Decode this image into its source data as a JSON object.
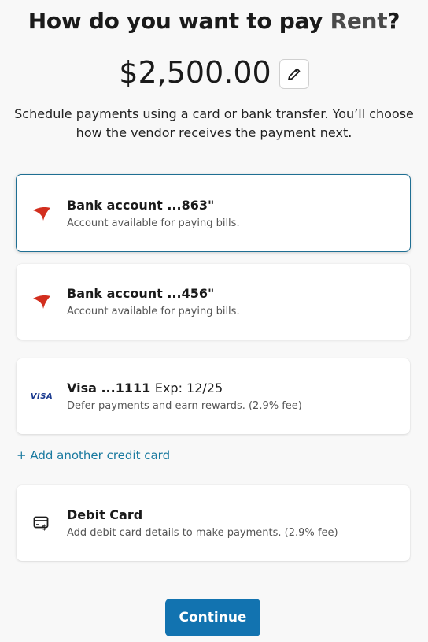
{
  "header": {
    "title_prefix": "How do you want to pay ",
    "vendor_name": "Rent",
    "title_suffix": "?"
  },
  "amount": "$2,500.00",
  "subtitle": "Schedule payments using a card or bank transfer. You’ll choose how the vendor receives the payment next.",
  "payment_methods": [
    {
      "title": "Bank account ...863\"",
      "description": "Account available for paying bills.",
      "icon": "bank-swoosh-icon",
      "selected": true
    },
    {
      "title": "Bank account ...456\"",
      "description": "Account available for paying bills.",
      "icon": "bank-swoosh-icon",
      "selected": false
    },
    {
      "title": "Visa ...1111",
      "expiry": "Exp: 12/25",
      "description": "Defer payments and earn rewards. (2.9% fee)",
      "icon_text": "VISA",
      "selected": false
    }
  ],
  "add_card_link": "+ Add another credit card",
  "debit_card": {
    "title": "Debit Card",
    "description": "Add debit card details to make payments. (2.9% fee)",
    "icon": "debit-card-icon"
  },
  "continue_label": "Continue",
  "colors": {
    "accent": "#1273b0",
    "link": "#1a7aa0",
    "selected_border": "#1f6f93",
    "bank_icon": "#d22e1e"
  }
}
